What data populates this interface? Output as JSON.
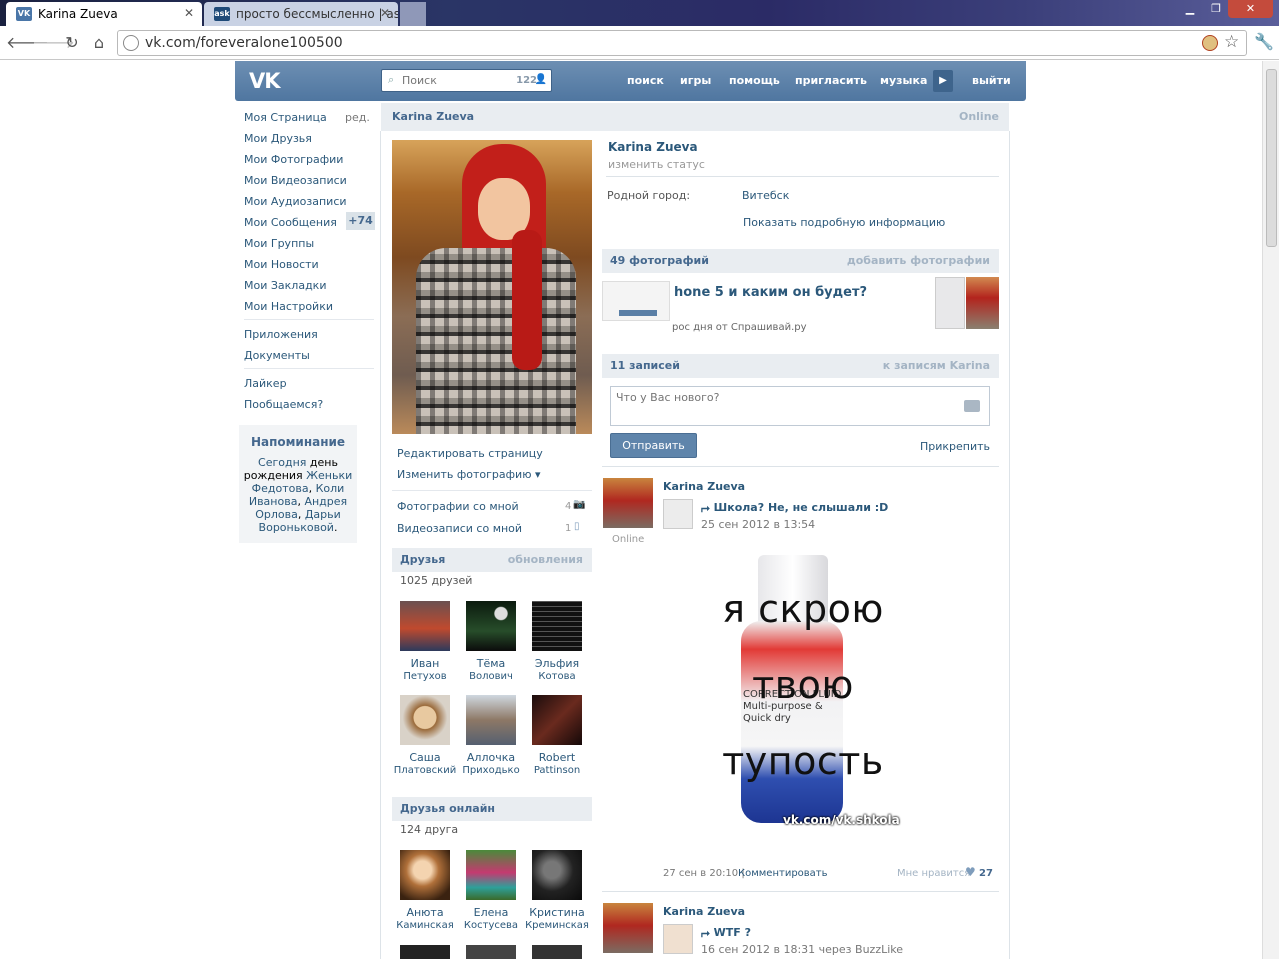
{
  "browser": {
    "tabs": [
      {
        "favicon": "VK",
        "title": "Karina Zueva"
      },
      {
        "favicon": "ask",
        "title": "просто бессмысленно | as"
      }
    ],
    "url": "vk.com/foreveralone100500"
  },
  "header": {
    "logo": "VK",
    "search_placeholder": "Поиск",
    "search_count": "122",
    "nav": [
      "поиск",
      "игры",
      "помощь",
      "пригласить",
      "музыка",
      "выйти"
    ]
  },
  "left_menu": {
    "items": [
      "Моя Страница",
      "Мои Друзья",
      "Мои Фотографии",
      "Мои Видеозаписи",
      "Мои Аудиозаписи",
      "Мои Сообщения",
      "Мои Группы",
      "Мои Новости",
      "Мои Закладки",
      "Мои Настройки",
      "Приложения",
      "Документы",
      "Лайкер",
      "Пообщаемся?"
    ],
    "edit": "ред.",
    "messages_badge": "+74",
    "reminder": {
      "title": "Напоминание",
      "today": "Сегодня",
      "birthday": "день рождения",
      "people": [
        {
          "name": "Женьки Федотова",
          "sep": ", "
        },
        {
          "name": "Коли Иванова",
          "sep": ", "
        },
        {
          "name": "Андрея Орлова",
          "sep": ", "
        },
        {
          "name": "Дарьи Вороньковой",
          "sep": "."
        }
      ]
    }
  },
  "profile": {
    "name": "Karina Zueva",
    "online": "Online",
    "status": "изменить статус",
    "hometown_label": "Родной город:",
    "hometown": "Витебск",
    "more_info": "Показать подробную информацию",
    "edit_page": "Редактировать страницу",
    "change_photo": "Изменить фотографию",
    "photos_with_me": "Фотографии со мной",
    "photos_with_me_count": "4",
    "videos_with_me": "Видеозаписи со мной",
    "videos_with_me_count": "1"
  },
  "friends": {
    "title": "Друзья",
    "updates": "обновления",
    "count": "1025 друзей",
    "list": [
      {
        "first": "Иван",
        "last": "Петухов"
      },
      {
        "first": "Тёма",
        "last": "Волович"
      },
      {
        "first": "Эльфия",
        "last": "Котова"
      },
      {
        "first": "Саша",
        "last": "Платовский"
      },
      {
        "first": "Аллочка",
        "last": "Приходько"
      },
      {
        "first": "Robert",
        "last": "Pattinson"
      }
    ]
  },
  "friends_online": {
    "title": "Друзья онлайн",
    "count": "124 друга",
    "list": [
      {
        "first": "Анюта",
        "last": "Каминская"
      },
      {
        "first": "Елена",
        "last": "Костусева"
      },
      {
        "first": "Кристина",
        "last": "Креминская"
      }
    ]
  },
  "photos": {
    "title": "49 фотографий",
    "add": "добавить фотографии",
    "strip_title": "hone 5 и каким он будет?",
    "strip_sub": "рос дня от Спрашивай.ру"
  },
  "wall": {
    "title": "11 записей",
    "to_posts": "к записям Karina",
    "placeholder": "Что у Вас нового?",
    "send": "Отправить",
    "attach": "Прикрепить"
  },
  "posts": [
    {
      "author": "Karina Zueva",
      "online": "Online",
      "repost_title": "Школа? Не, не слышали :D",
      "repost_date": "25 сен 2012 в 13:54",
      "meme_lines": [
        "я скрою",
        "твою",
        "тупость"
      ],
      "meme_watermark": "vk.com/vk.shkola",
      "bottle_text": "CORRECTION FLUID Multi-purpose & Quick dry",
      "date": "27 сен в 20:10",
      "comment": "Комментировать",
      "like_label": "Мне нравится",
      "likes": "27"
    },
    {
      "author": "Karina Zueva",
      "repost_title": "WTF ?",
      "repost_date": "16 сен 2012 в 18:31 через BuzzLike"
    }
  ],
  "colors": {
    "vk_blue": "#5a7fa6",
    "link": "#2b587a",
    "block_head": "#e9edf1"
  }
}
